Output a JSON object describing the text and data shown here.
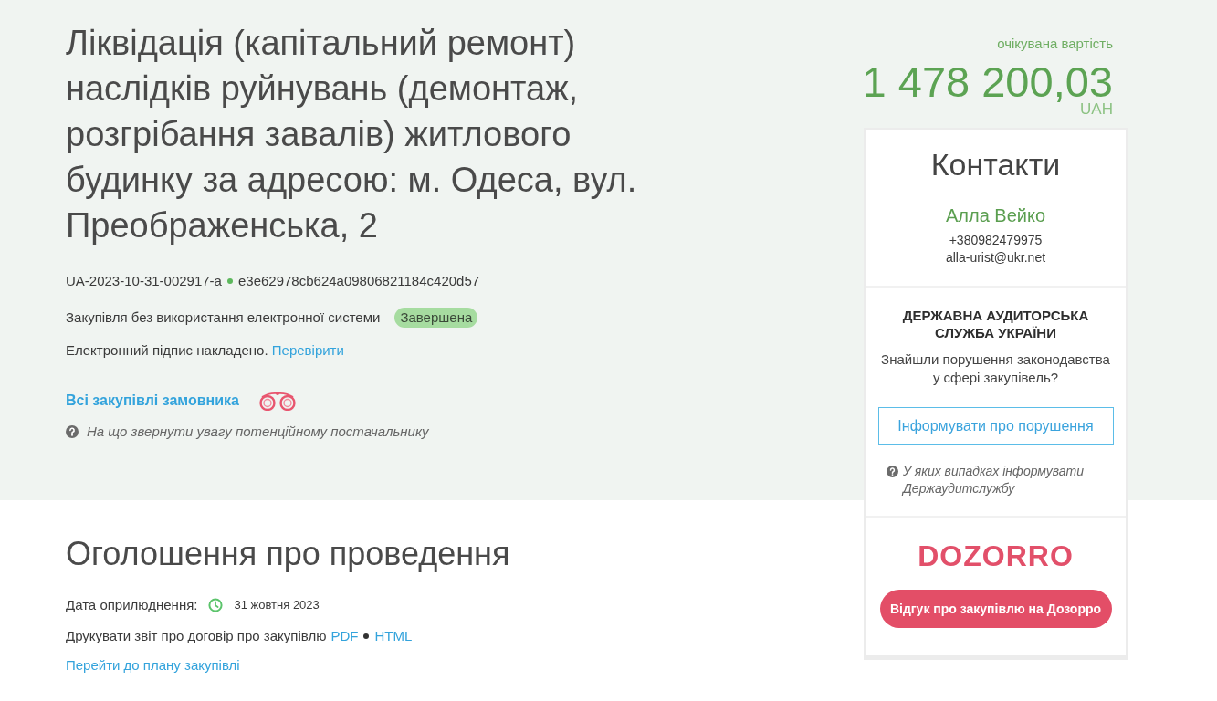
{
  "tender": {
    "title": "Ліквідація (капітальний ремонт) наслідків руйнувань (демонтаж, розгрібання завалів) житлового будинку за адресою: м. Одеса, вул. Преображенська, 2",
    "id": "UA-2023-10-31-002917-a",
    "hash": "e3e62978cb624a09806821184c420d57",
    "procurement_type": "Закупівля без використання електронної системи",
    "status": "Завершена",
    "signature": {
      "text": "Електронний підпис накладено.",
      "link": "Перевірити"
    },
    "customer_link": "Всі закупівлі замовника",
    "supplier_hint": "На що звернути увагу потенційному постачальнику"
  },
  "value": {
    "label": "очікувана вартість",
    "amount": "1 478 200,03",
    "currency": "UAH"
  },
  "contacts": {
    "title": "Контакти",
    "name": "Алла Вейко",
    "phone": "+380982479975",
    "email": "alla-urist@ukr.net"
  },
  "audit": {
    "title": "ДЕРЖАВНА АУДИТОРСЬКА СЛУЖБА УКРАЇНИ",
    "question": "Знайшли порушення законодавства у сфері закупівель?",
    "button": "Інформувати про порушення",
    "hint": "У яких випадках інформувати Держаудитслужбу"
  },
  "dozorro": {
    "logo": "DOZORRO",
    "button": "Відгук про закупівлю на Дозорро"
  },
  "announcement": {
    "title": "Оголошення про проведення",
    "published_label": "Дата оприлюднення:",
    "published_date": "31 жовтня 2023",
    "print_label": "Друкувати звіт про договір про закупівлю",
    "print_links": [
      "PDF",
      "HTML"
    ],
    "plan_link": "Перейти до плану закупівлі"
  }
}
